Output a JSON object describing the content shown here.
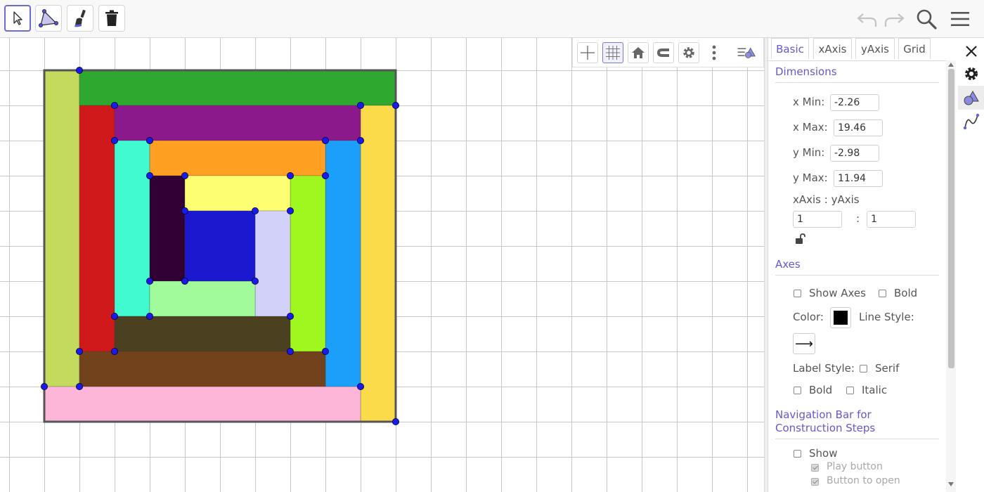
{
  "toolbar": {
    "tools": [
      {
        "id": "move",
        "icon": "arrow-cursor-icon",
        "selected": true
      },
      {
        "id": "polygon",
        "icon": "polygon-icon"
      },
      {
        "id": "brush",
        "icon": "brush-icon"
      },
      {
        "id": "delete",
        "icon": "trash-icon"
      }
    ],
    "right": [
      "undo-icon",
      "redo-icon",
      "search-icon",
      "menu-icon"
    ]
  },
  "style_bar": {
    "buttons": [
      "axes-icon",
      "grid-icon",
      "home-icon",
      "magnet-icon",
      "gear-icon",
      "more-vertical-icon",
      "toggle-style-bar-icon"
    ],
    "active": "grid-icon"
  },
  "properties": {
    "tabs": [
      {
        "label": "Basic",
        "active": true
      },
      {
        "label": "xAxis"
      },
      {
        "label": "yAxis"
      },
      {
        "label": "Grid"
      }
    ],
    "dimensions": {
      "title": "Dimensions",
      "xmin_label": "x Min:",
      "xmin_value": "-2.26",
      "xmax_label": "x Max:",
      "xmax_value": "19.46",
      "ymin_label": "y Min:",
      "ymin_value": "-2.98",
      "ymax_label": "y Max:",
      "ymax_value": "11.94",
      "ratio_label": "xAxis : yAxis",
      "ratio_x": "1",
      "ratio_sep": ":",
      "ratio_y": "1"
    },
    "axes": {
      "title": "Axes",
      "show_axes": "Show Axes",
      "bold": "Bold",
      "color_label": "Color:",
      "color_value": "#000000",
      "line_style_label": "Line Style:",
      "line_style_value": "⟶",
      "label_style_label": "Label Style:",
      "serif": "Serif",
      "bold2": "Bold",
      "italic": "Italic"
    },
    "navigation": {
      "title": "Navigation Bar for Construction Steps",
      "show": "Show",
      "play_button": "Play button",
      "button_to_open": "Button to open"
    },
    "side_icons": [
      "gear-icon",
      "graphics-view-icon",
      "algebra-curve-icon"
    ],
    "close": "close-icon"
  },
  "canvas": {
    "grid_step": 1,
    "polygons": [
      {
        "name": "outer-frame",
        "color": "#ffffff",
        "points": [
          [
            0,
            0
          ],
          [
            10,
            0
          ],
          [
            10,
            10
          ],
          [
            0,
            10
          ]
        ]
      },
      {
        "name": "lime-left-strip",
        "color": "#c3da5c",
        "points": [
          [
            0,
            1
          ],
          [
            1,
            1
          ],
          [
            1,
            10
          ],
          [
            0,
            10
          ]
        ]
      },
      {
        "name": "green-top-strip",
        "color": "#2fa82f",
        "points": [
          [
            1,
            9
          ],
          [
            10,
            9
          ],
          [
            10,
            10
          ],
          [
            1,
            10
          ]
        ]
      },
      {
        "name": "yellow-right-strip",
        "color": "#fbdb4a",
        "points": [
          [
            9,
            0
          ],
          [
            10,
            0
          ],
          [
            10,
            9
          ],
          [
            9,
            9
          ]
        ]
      },
      {
        "name": "pink-bottom-strip",
        "color": "#fdb6d8",
        "points": [
          [
            0,
            0
          ],
          [
            9,
            0
          ],
          [
            9,
            1
          ],
          [
            0,
            1
          ]
        ]
      },
      {
        "name": "red-strip",
        "color": "#d0191b",
        "points": [
          [
            1,
            2
          ],
          [
            2,
            2
          ],
          [
            2,
            9
          ],
          [
            1,
            9
          ]
        ]
      },
      {
        "name": "purple-strip",
        "color": "#8c198c",
        "points": [
          [
            2,
            8
          ],
          [
            9,
            8
          ],
          [
            9,
            9
          ],
          [
            2,
            9
          ]
        ]
      },
      {
        "name": "blue-strip",
        "color": "#1b9ff9",
        "points": [
          [
            8,
            1
          ],
          [
            9,
            1
          ],
          [
            9,
            8
          ],
          [
            8,
            8
          ]
        ]
      },
      {
        "name": "brown-strip",
        "color": "#72421c",
        "points": [
          [
            1,
            1
          ],
          [
            8,
            1
          ],
          [
            8,
            2
          ],
          [
            1,
            2
          ]
        ]
      },
      {
        "name": "turquoise-strip",
        "color": "#41fad0",
        "points": [
          [
            2,
            3
          ],
          [
            3,
            3
          ],
          [
            3,
            8
          ],
          [
            2,
            8
          ]
        ]
      },
      {
        "name": "orange-strip",
        "color": "#ffa022",
        "points": [
          [
            3,
            7
          ],
          [
            8,
            7
          ],
          [
            8,
            8
          ],
          [
            3,
            8
          ]
        ]
      },
      {
        "name": "lime-green-strip",
        "color": "#a0f71f",
        "points": [
          [
            7,
            2
          ],
          [
            8,
            2
          ],
          [
            8,
            7
          ],
          [
            7,
            7
          ]
        ]
      },
      {
        "name": "dark-olive-strip",
        "color": "#4b4120",
        "points": [
          [
            2,
            2
          ],
          [
            7,
            2
          ],
          [
            7,
            3
          ],
          [
            2,
            3
          ]
        ]
      },
      {
        "name": "dark-maroon-strip",
        "color": "#320034",
        "points": [
          [
            3,
            4
          ],
          [
            4,
            4
          ],
          [
            4,
            7
          ],
          [
            3,
            7
          ]
        ]
      },
      {
        "name": "light-yellow-strip",
        "color": "#fefe73",
        "points": [
          [
            4,
            6
          ],
          [
            7,
            6
          ],
          [
            7,
            7
          ],
          [
            4,
            7
          ]
        ]
      },
      {
        "name": "lavender-strip",
        "color": "#d1d1f9",
        "points": [
          [
            6,
            3
          ],
          [
            7,
            3
          ],
          [
            7,
            6
          ],
          [
            6,
            6
          ]
        ]
      },
      {
        "name": "light-green-strip",
        "color": "#a1fb9b",
        "points": [
          [
            3,
            3
          ],
          [
            6,
            3
          ],
          [
            6,
            4
          ],
          [
            3,
            4
          ]
        ]
      },
      {
        "name": "center-blue-square",
        "color": "#1b19cf",
        "points": [
          [
            4,
            4
          ],
          [
            6,
            4
          ],
          [
            6,
            6
          ],
          [
            4,
            6
          ]
        ]
      }
    ],
    "points": [
      [
        0,
        1
      ],
      [
        1,
        1
      ],
      [
        1,
        10
      ],
      [
        10,
        9
      ],
      [
        10,
        0
      ],
      [
        9,
        1
      ],
      [
        9,
        8
      ],
      [
        9,
        9
      ],
      [
        2,
        9
      ],
      [
        2,
        8
      ],
      [
        8,
        8
      ],
      [
        8,
        7
      ],
      [
        8,
        2
      ],
      [
        1,
        2
      ],
      [
        2,
        2
      ],
      [
        2,
        3
      ],
      [
        3,
        3
      ],
      [
        3,
        4
      ],
      [
        3,
        8
      ],
      [
        3,
        7
      ],
      [
        4,
        7
      ],
      [
        7,
        7
      ],
      [
        7,
        6
      ],
      [
        7,
        3
      ],
      [
        7,
        2
      ],
      [
        4,
        4
      ],
      [
        4,
        6
      ],
      [
        6,
        6
      ],
      [
        6,
        4
      ]
    ]
  }
}
